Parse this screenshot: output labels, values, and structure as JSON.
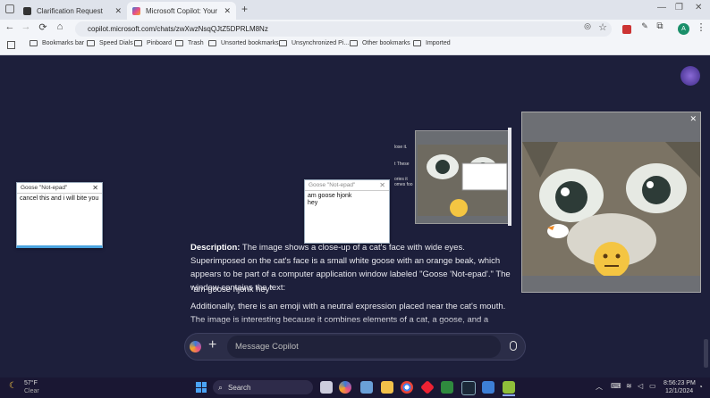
{
  "browser": {
    "tabs": [
      {
        "title": "Clarification Request",
        "fav_color": "#222"
      },
      {
        "title": "Microsoft Copilot: Your AI com",
        "fav_color": "#3b7bd6"
      }
    ],
    "new_tab": "+",
    "url": "copilot.microsoft.com/chats/zwXwzNsqQJtZ5DPRLM8Nz",
    "profile_initial": "A",
    "bookmarks": [
      "Bookmarks bar",
      "Speed Dials",
      "Pinboard",
      "Trash",
      "Unsorted bookmarks",
      "Unsynchronized Pi...",
      "Other bookmarks",
      "Imported"
    ]
  },
  "goose_window_left": {
    "title": "Goose \"Not-epad\"",
    "text": "cancel this and i will bite you"
  },
  "goose_window_mid": {
    "title": "Goose \"Not-epad\"",
    "text1": "am goose hjonk",
    "text2": "hey"
  },
  "thumb_snippets": [
    "lose it.",
    "t These",
    "ories it",
    "omes foo"
  ],
  "description": {
    "label": "Description:",
    "text": "The image shows a close-up of a cat's face with wide eyes. Superimposed on the cat's face is a small white goose with an orange beak, which appears to be part of a computer application window labeled \"Goose 'Not-epad'.\" The window contains the text:",
    "quote": "\"am goose hjonk hey\"",
    "more": "Additionally, there is an emoji with a neutral expression placed near the cat's mouth. The image is interesting because it combines elements of a cat, a goose, and a computer application in a humorous and unexpected way."
  },
  "composer": {
    "placeholder": "Message Copilot"
  },
  "taskbar": {
    "weather_temp": "57°F",
    "weather_cond": "Clear",
    "search": "Search",
    "time": "8:56:23 PM",
    "date": "12/1/2024"
  }
}
